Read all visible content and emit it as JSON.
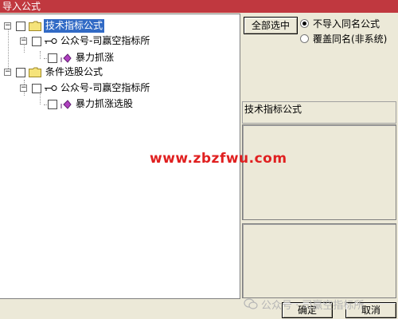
{
  "window": {
    "title": "导入公式"
  },
  "tree": {
    "groups": [
      {
        "label": "技术指标公式",
        "selected": true,
        "expander": "−",
        "child": {
          "label": "公众号-司赢空指标所",
          "expander": "−",
          "leaf": {
            "label": "暴力抓涨"
          }
        }
      },
      {
        "label": "条件选股公式",
        "selected": false,
        "expander": "−",
        "child": {
          "label": "公众号-司赢空指标所",
          "expander": "−",
          "leaf": {
            "label": "暴力抓涨选股"
          }
        }
      }
    ]
  },
  "options": {
    "select_all_label": "全部选中",
    "radio_no_import": "不导入同名公式",
    "radio_overwrite": "覆盖同名(非系统)",
    "selected_radio": "no_import"
  },
  "info": {
    "type_label": "技术指标公式"
  },
  "watermark": {
    "site": "www.zbzfwu.com",
    "wechat": "公众号 · 司赢空指标所"
  },
  "footer": {
    "ok_label": "确定",
    "cancel_label": "取消"
  },
  "colors": {
    "titlebar": "#c0383f",
    "selection": "#316ac5",
    "watermark": "#e02020"
  }
}
